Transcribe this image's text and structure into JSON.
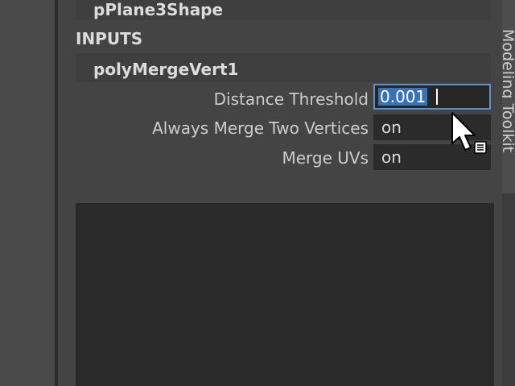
{
  "right_tab": {
    "label": "Modeling Toolkit"
  },
  "shape_header": {
    "title": "pPlane3Shape"
  },
  "inputs": {
    "section_label": "INPUTS",
    "node": {
      "title": "polyMergeVert1",
      "attributes": [
        {
          "label": "Distance Threshold",
          "value": "0.001",
          "editing": true
        },
        {
          "label": "Always Merge Two Vertices",
          "value": "on"
        },
        {
          "label": "Merge UVs",
          "value": "on"
        }
      ]
    }
  },
  "colors": {
    "panel_bg": "#444444",
    "field_bg": "#2b2b2b",
    "selection": "#3873b8",
    "focus_border": "#5d90c6"
  },
  "icons": {
    "cursor": "arrow-cursor-with-list-badge"
  }
}
